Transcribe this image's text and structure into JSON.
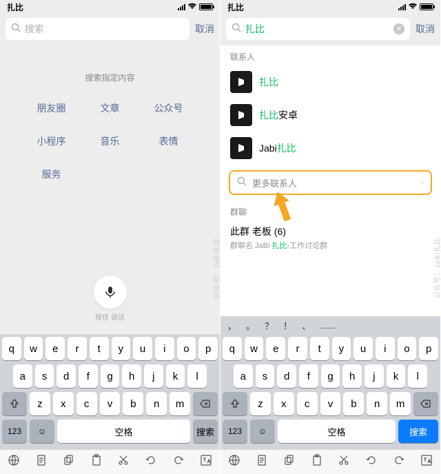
{
  "status": {
    "title": "扎比"
  },
  "left": {
    "search_placeholder": "搜索",
    "cancel": "取消",
    "cat_title": "搜索指定内容",
    "cats": [
      "朋友圈",
      "文章",
      "公众号",
      "小程序",
      "音乐",
      "表情",
      "服务"
    ],
    "mic_hint": "按住 说话"
  },
  "right": {
    "search_value": "扎比",
    "cancel": "取消",
    "section_contacts": "联系人",
    "contacts": [
      {
        "pre": "",
        "hl": "扎比",
        "post": ""
      },
      {
        "pre": "",
        "hl": "扎比",
        "post": "安卓"
      },
      {
        "pre": "Jabi",
        "hl": "扎比",
        "post": ""
      }
    ],
    "more_contacts": "更多联系人",
    "section_groups": "群聊",
    "group": {
      "name": "此群    老板 (6)",
      "sub_pre": "群聊名   JaBi ",
      "sub_hl": "扎比",
      "sub_post": "-工作讨论群"
    }
  },
  "predict": [
    "，",
    "。",
    "？",
    "！",
    "、",
    "......"
  ],
  "keys": {
    "r1": [
      "q",
      "w",
      "e",
      "r",
      "t",
      "y",
      "u",
      "i",
      "o",
      "p"
    ],
    "r2": [
      "a",
      "s",
      "d",
      "f",
      "g",
      "h",
      "j",
      "k",
      "l"
    ],
    "r3": [
      "z",
      "x",
      "c",
      "v",
      "b",
      "n",
      "m"
    ],
    "num": "123",
    "space": "空格",
    "searchL": "搜索",
    "searchR": "搜索"
  },
  "watermark": "公众号：JaBi扎比"
}
